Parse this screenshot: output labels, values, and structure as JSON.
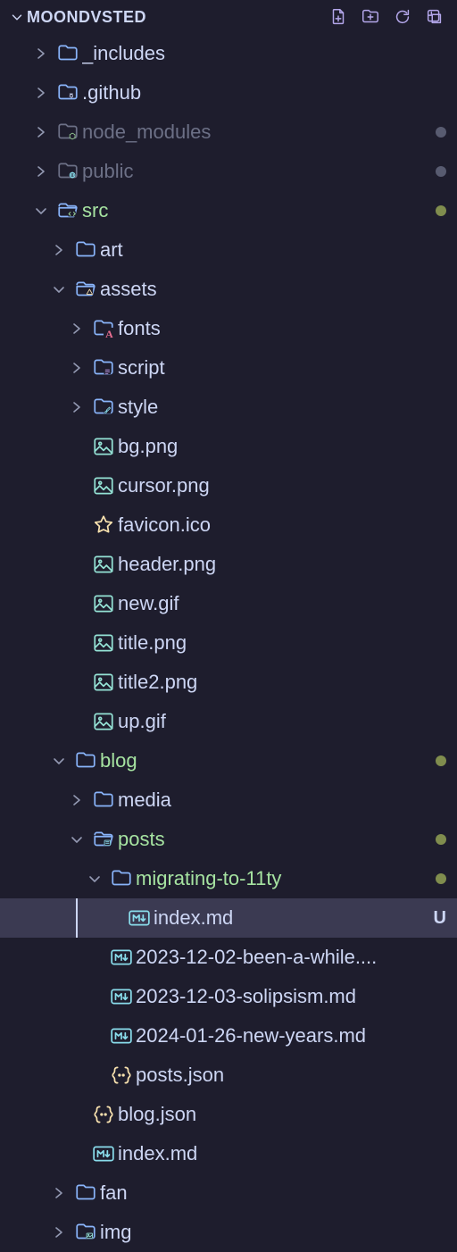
{
  "header": {
    "title": "MOONDVSTED"
  },
  "tree": [
    {
      "depth": 0,
      "chev": "right",
      "icon": "folder",
      "label": "_includes",
      "style": "normal"
    },
    {
      "depth": 0,
      "chev": "right",
      "icon": "folder-github",
      "label": ".github",
      "style": "normal"
    },
    {
      "depth": 0,
      "chev": "right",
      "icon": "folder-node",
      "label": "node_modules",
      "style": "dim",
      "dot": "gray"
    },
    {
      "depth": 0,
      "chev": "right",
      "icon": "folder-public",
      "label": "public",
      "style": "dim",
      "dot": "gray"
    },
    {
      "depth": 0,
      "chev": "down",
      "icon": "folder-src",
      "label": "src",
      "style": "green",
      "dot": "olive"
    },
    {
      "depth": 1,
      "chev": "right",
      "icon": "folder",
      "label": "art",
      "style": "normal"
    },
    {
      "depth": 1,
      "chev": "down",
      "icon": "folder-assets",
      "label": "assets",
      "style": "normal"
    },
    {
      "depth": 2,
      "chev": "right",
      "icon": "folder-font",
      "label": "fonts",
      "style": "normal"
    },
    {
      "depth": 2,
      "chev": "right",
      "icon": "folder-script",
      "label": "script",
      "style": "normal"
    },
    {
      "depth": 2,
      "chev": "right",
      "icon": "folder-style",
      "label": "style",
      "style": "normal"
    },
    {
      "depth": 2,
      "chev": "",
      "icon": "image",
      "label": "bg.png",
      "style": "normal"
    },
    {
      "depth": 2,
      "chev": "",
      "icon": "image",
      "label": "cursor.png",
      "style": "normal"
    },
    {
      "depth": 2,
      "chev": "",
      "icon": "favicon",
      "label": "favicon.ico",
      "style": "normal"
    },
    {
      "depth": 2,
      "chev": "",
      "icon": "image",
      "label": "header.png",
      "style": "normal"
    },
    {
      "depth": 2,
      "chev": "",
      "icon": "image",
      "label": "new.gif",
      "style": "normal"
    },
    {
      "depth": 2,
      "chev": "",
      "icon": "image",
      "label": "title.png",
      "style": "normal"
    },
    {
      "depth": 2,
      "chev": "",
      "icon": "image",
      "label": "title2.png",
      "style": "normal"
    },
    {
      "depth": 2,
      "chev": "",
      "icon": "image",
      "label": "up.gif",
      "style": "normal"
    },
    {
      "depth": 1,
      "chev": "down",
      "icon": "folder",
      "label": "blog",
      "style": "green",
      "dot": "olive"
    },
    {
      "depth": 2,
      "chev": "right",
      "icon": "folder",
      "label": "media",
      "style": "normal"
    },
    {
      "depth": 2,
      "chev": "down",
      "icon": "folder-posts",
      "label": "posts",
      "style": "green",
      "dot": "olive"
    },
    {
      "depth": 3,
      "chev": "down",
      "icon": "folder",
      "label": "migrating-to-11ty",
      "style": "green",
      "dot": "olive"
    },
    {
      "depth": 4,
      "chev": "",
      "icon": "markdown",
      "label": "index.md",
      "style": "normal",
      "status": "U",
      "selected": true
    },
    {
      "depth": 3,
      "chev": "",
      "icon": "markdown",
      "label": "2023-12-02-been-a-while....",
      "style": "normal"
    },
    {
      "depth": 3,
      "chev": "",
      "icon": "markdown",
      "label": "2023-12-03-solipsism.md",
      "style": "normal"
    },
    {
      "depth": 3,
      "chev": "",
      "icon": "markdown",
      "label": "2024-01-26-new-years.md",
      "style": "normal"
    },
    {
      "depth": 3,
      "chev": "",
      "icon": "json",
      "label": "posts.json",
      "style": "normal"
    },
    {
      "depth": 2,
      "chev": "",
      "icon": "json",
      "label": "blog.json",
      "style": "normal"
    },
    {
      "depth": 2,
      "chev": "",
      "icon": "markdown",
      "label": "index.md",
      "style": "normal"
    },
    {
      "depth": 1,
      "chev": "right",
      "icon": "folder",
      "label": "fan",
      "style": "normal"
    },
    {
      "depth": 1,
      "chev": "right",
      "icon": "folder-img",
      "label": "img",
      "style": "normal"
    }
  ],
  "colors": {
    "folder": "#89b4fa",
    "folderSpecial": "#89b4fa",
    "image": "#94e2d5",
    "favicon": "#f9e2af",
    "markdown": "#89dceb",
    "json": "#f9e2af",
    "chev": "#9399b2",
    "action": "#b4a7eb"
  }
}
